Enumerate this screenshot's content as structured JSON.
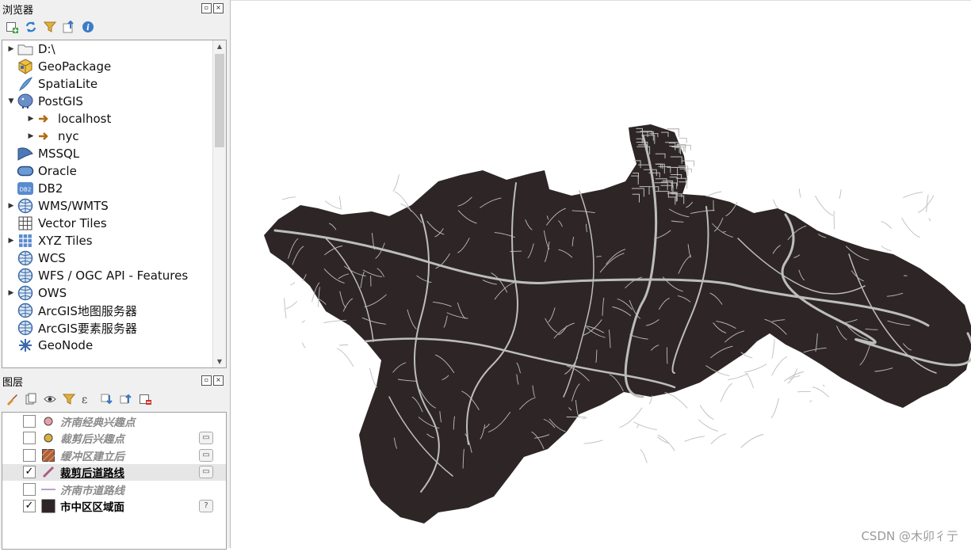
{
  "browser": {
    "title": "浏览器",
    "items": [
      {
        "label": "D:\\",
        "icon": "folder-icon"
      },
      {
        "label": "GeoPackage",
        "icon": "geopackage-icon"
      },
      {
        "label": "SpatiaLite",
        "icon": "spatialite-feather-icon"
      },
      {
        "label": "PostGIS",
        "icon": "postgis-elephant-icon"
      },
      {
        "label": "localhost",
        "icon": "connection-icon"
      },
      {
        "label": "nyc",
        "icon": "connection-icon"
      },
      {
        "label": "MSSQL",
        "icon": "mssql-icon"
      },
      {
        "label": "Oracle",
        "icon": "oracle-icon"
      },
      {
        "label": "DB2",
        "icon": "db2-icon"
      },
      {
        "label": "WMS/WMTS",
        "icon": "globe-icon"
      },
      {
        "label": "Vector Tiles",
        "icon": "grid-icon"
      },
      {
        "label": "XYZ Tiles",
        "icon": "tiles-icon"
      },
      {
        "label": "WCS",
        "icon": "globe-icon"
      },
      {
        "label": "WFS / OGC API - Features",
        "icon": "globe-icon"
      },
      {
        "label": "OWS",
        "icon": "globe-icon"
      },
      {
        "label": "ArcGIS地图服务器",
        "icon": "globe-icon"
      },
      {
        "label": "ArcGIS要素服务器",
        "icon": "globe-icon"
      },
      {
        "label": "GeoNode",
        "icon": "geonode-icon"
      }
    ]
  },
  "layers": {
    "title": "图层",
    "items": [
      {
        "label": "济南经典兴趣点",
        "checked": false,
        "symbol_color": "#e8a0a8"
      },
      {
        "label": "裁剪后兴趣点",
        "checked": false,
        "symbol_color": "#d8b040"
      },
      {
        "label": "缓冲区建立后",
        "checked": false,
        "symbol_color": "#b0603a"
      },
      {
        "label": "裁剪后道路线",
        "checked": true,
        "symbol_color": "#c0508a"
      },
      {
        "label": "济南市道路线",
        "checked": false,
        "symbol_color": "#a080c0"
      },
      {
        "label": "市中区区域面",
        "checked": true,
        "symbol_color": "#2e2626"
      }
    ],
    "check_mark": "✓",
    "unknown_crs_badge": "?"
  },
  "map": {
    "fill_color": "#2e2626",
    "road_color": "#bdbdbd"
  },
  "watermark": "CSDN @木卯彳亍"
}
